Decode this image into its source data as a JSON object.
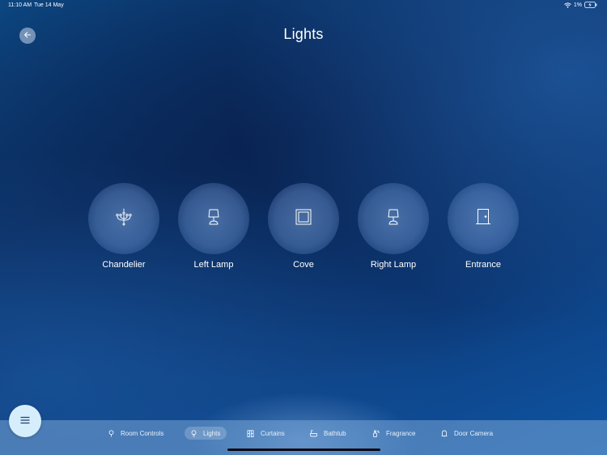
{
  "status_bar": {
    "time": "11:10 AM",
    "date": "Tue 14 May",
    "battery": "1%",
    "icons": [
      "wifi-icon",
      "battery-charging-icon"
    ]
  },
  "header": {
    "title": "Lights",
    "back_icon": "arrow-left-icon"
  },
  "lights": [
    {
      "label": "Chandelier",
      "icon": "chandelier-icon"
    },
    {
      "label": "Left Lamp",
      "icon": "table-lamp-icon"
    },
    {
      "label": "Cove",
      "icon": "cove-light-icon"
    },
    {
      "label": "Right Lamp",
      "icon": "table-lamp-icon"
    },
    {
      "label": "Entrance",
      "icon": "door-icon"
    }
  ],
  "bottom_nav": {
    "active": "Lights",
    "tabs": [
      {
        "label": "Room Controls",
        "icon": "pin-icon"
      },
      {
        "label": "Lights",
        "icon": "bulb-icon"
      },
      {
        "label": "Curtains",
        "icon": "curtains-icon"
      },
      {
        "label": "Bathtub",
        "icon": "bathtub-icon"
      },
      {
        "label": "Fragrance",
        "icon": "fragrance-icon"
      },
      {
        "label": "Door Camera",
        "icon": "bell-icon"
      }
    ]
  },
  "menu_button_icon": "hamburger-icon",
  "colors": {
    "background_top": "#0c2f63",
    "background_bottom": "#0f55a4",
    "nav_bar": "#7aa5d7",
    "menu_button": "#d6eefc"
  }
}
